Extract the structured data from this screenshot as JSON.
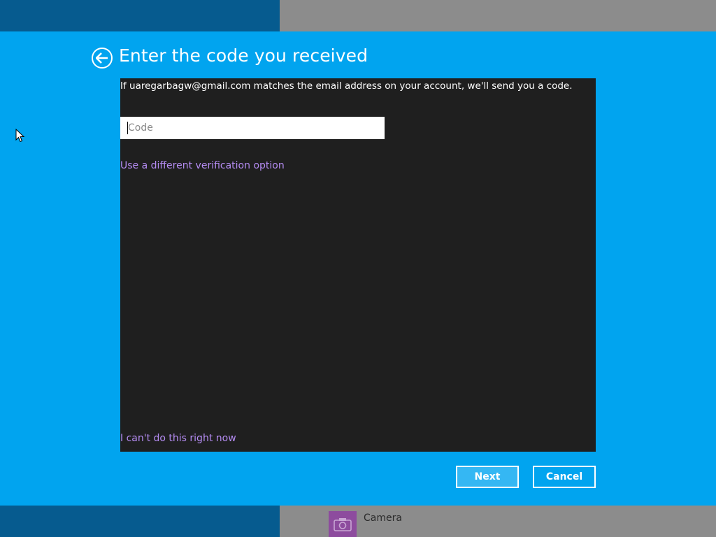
{
  "dialog": {
    "title": "Enter the code you received",
    "info_text": "If uaregarbagw@gmail.com matches the email address on your account, we'll send you a code.",
    "code_input": {
      "value": "",
      "placeholder": "Code"
    },
    "different_option_link": "Use a different verification option",
    "cant_do_link": "I can't do this right now",
    "buttons": {
      "next_label": "Next",
      "cancel_label": "Cancel"
    }
  },
  "background_app": {
    "tile_label": "Camera",
    "tile_icon": "camera-icon"
  },
  "colors": {
    "dialog_bg": "#01a4ef",
    "panel_bg": "#1f1f1f",
    "link": "#b58cf3",
    "primary_button_bg": "#35b7f3"
  }
}
